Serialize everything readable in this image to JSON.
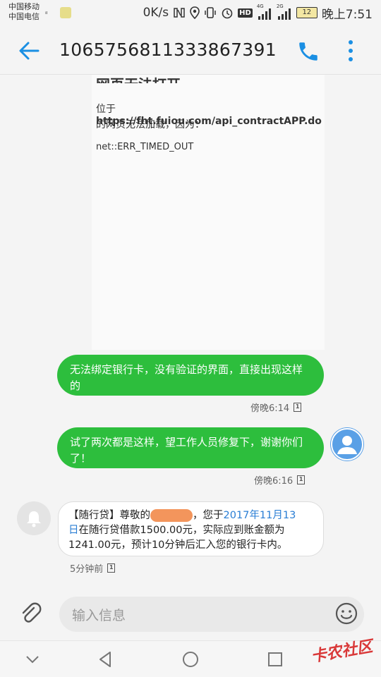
{
  "status_bar": {
    "carrier1": "中国移动",
    "carrier2": "中国电信",
    "net_speed": "0K/s",
    "hd": "HD",
    "net1": "4G",
    "net2": "2G",
    "battery": "12",
    "time": "晚上7:51"
  },
  "header": {
    "phone_number": "1065756811333867391"
  },
  "screenshot": {
    "title": "网页无法打开",
    "line1_prefix": "位于 ",
    "line1_url": "https://fht.fuiou.com/api_contractAPP.do",
    "line2": "的网页无法加载，因为：",
    "error": "net::ERR_TIMED_OUT"
  },
  "messages": [
    {
      "direction": "out",
      "text_line1": "无法绑定银行卡，没有验证的界面，直接出现这样",
      "text_line2": "的",
      "time": "傍晚6:14",
      "sim": "1"
    },
    {
      "direction": "out",
      "text_line1": "试了两次都是这样，望工作人员修复下，谢谢你们",
      "text_line2": "了！",
      "time": "傍晚6:16",
      "sim": "1"
    },
    {
      "direction": "in",
      "part1": "【随行贷】尊敬的",
      "part2": "，您于",
      "date_link_a": "2017年11月13",
      "date_link_b": "日",
      "part3": "在随行贷借款1500.00元，实际应到账金额为",
      "part4": "1241.00元，预计10分钟后汇入您的银行卡内。",
      "time": "5分钟前",
      "sim": "1"
    }
  ],
  "composer": {
    "placeholder": "输入信息"
  },
  "watermark": "卡农社区",
  "colors": {
    "accent": "#1a8fe3",
    "bubble_out": "#2dbe3d",
    "link": "#2a7ed4"
  },
  "icons": [
    "back-arrow-icon",
    "phone-call-icon",
    "more-vert-icon",
    "paperclip-icon",
    "emoji-icon",
    "bell-icon",
    "user-avatar-icon",
    "nav-down-icon",
    "nav-back-icon",
    "nav-home-icon",
    "nav-recents-icon"
  ]
}
